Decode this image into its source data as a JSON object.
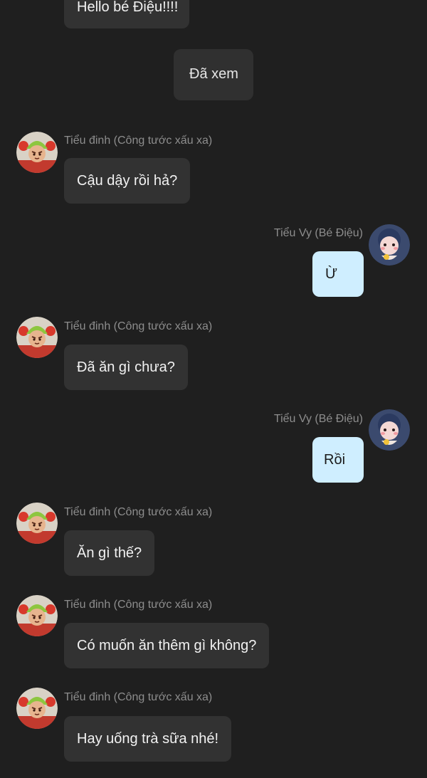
{
  "messages": {
    "m0": "Hello bé Điệu!!!!",
    "m1": "Đã xem",
    "m2": "Cậu dậy rồi hả?",
    "m3": "Ừ",
    "m4": "Đã ăn gì chưa?",
    "m5": "Rồi",
    "m6": "Ăn gì thế?",
    "m7": "Có muốn ăn thêm gì không?",
    "m8": "Hay uống trà sữa nhé!"
  },
  "senders": {
    "other": "Tiểu đinh (Công tước xấu xa)",
    "me": "Tiểu Vy (Bé Điệu)"
  },
  "colors": {
    "background": "#1f1f1f",
    "incoming_bubble": "#323232",
    "outgoing_bubble": "#cfeeff",
    "sender_text": "#8d8d8d"
  },
  "icons": {
    "other_avatar": "green-hat-character-avatar-icon",
    "me_avatar": "pink-bear-character-avatar-icon"
  }
}
